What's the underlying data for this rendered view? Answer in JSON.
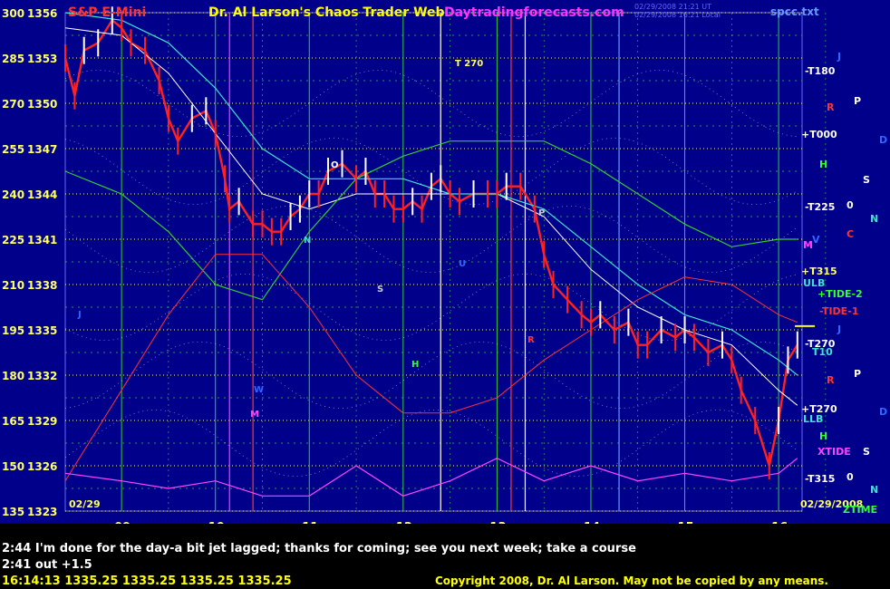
{
  "header": {
    "instrument": "S&P E-Mini",
    "author": "Dr. Al Larson's Chaos Trader Web",
    "site": "Daytradingforecasts.com",
    "timestamp1": "02/29/2008 21:21 UT",
    "timestamp2": "02/29/2008 16:21 Local",
    "file": "spcc.txt"
  },
  "colors": {
    "background": "#00008b",
    "price": "#ff0000",
    "price_up": "#ffffff",
    "grid_yellow": "#ffff66",
    "grid_green": "#33cc33",
    "cyan": "#40e0d0",
    "magenta": "#ff00ff"
  },
  "chart_data": {
    "type": "line",
    "y_left_labels": [
      "300",
      "285",
      "270",
      "255",
      "240",
      "225",
      "210",
      "195",
      "180",
      "165",
      "150",
      "135"
    ],
    "y_right_labels": [
      "1356",
      "1353",
      "1350",
      "1347",
      "1344",
      "1341",
      "1338",
      "1335",
      "1332",
      "1329",
      "1326",
      "1323"
    ],
    "ylim": [
      1323,
      1356
    ],
    "x_ticks": [
      "09",
      "10",
      "11",
      "12",
      "13",
      "14",
      "15",
      "16"
    ],
    "x_range": [
      8.4,
      16.25
    ],
    "date_left": "02/29",
    "date_right": "02/29/2008",
    "series": [
      {
        "name": "price",
        "x": [
          8.4,
          8.5,
          8.6,
          8.75,
          8.9,
          9.0,
          9.1,
          9.25,
          9.4,
          9.5,
          9.6,
          9.75,
          9.9,
          10.0,
          10.1,
          10.15,
          10.25,
          10.4,
          10.5,
          10.6,
          10.7,
          10.8,
          10.9,
          11.0,
          11.1,
          11.2,
          11.35,
          11.5,
          11.6,
          11.7,
          11.8,
          11.9,
          12.0,
          12.1,
          12.2,
          12.3,
          12.4,
          12.5,
          12.6,
          12.75,
          12.9,
          13.0,
          13.1,
          13.25,
          13.4,
          13.5,
          13.6,
          13.75,
          13.9,
          14.0,
          14.1,
          14.25,
          14.4,
          14.5,
          14.6,
          14.75,
          14.9,
          15.0,
          15.1,
          15.25,
          15.4,
          15.5,
          15.6,
          15.75,
          15.9,
          16.0,
          16.1,
          16.2
        ],
        "y": [
          1353,
          1350.5,
          1353.5,
          1354,
          1355.5,
          1355,
          1354,
          1353.5,
          1351.5,
          1349,
          1347.5,
          1349,
          1349.5,
          1348,
          1345,
          1343,
          1343.5,
          1342,
          1342,
          1341.5,
          1341.5,
          1342.5,
          1343,
          1344,
          1344,
          1345.5,
          1346,
          1345,
          1345.5,
          1344,
          1344,
          1343,
          1343,
          1343.5,
          1343,
          1344.5,
          1345,
          1344,
          1343.5,
          1344,
          1344,
          1344,
          1344.5,
          1344.5,
          1343,
          1340,
          1338,
          1337,
          1336,
          1335.5,
          1336,
          1335,
          1335.5,
          1334,
          1334,
          1335,
          1334.5,
          1335,
          1334.5,
          1333.5,
          1334,
          1333,
          1331,
          1329,
          1326,
          1329,
          1333,
          1334
        ]
      },
      {
        "name": "",
        "x": [
          8.4,
          9,
          9.5,
          10,
          10.5,
          11,
          11.5,
          12,
          12.5,
          13,
          13.5,
          14,
          14.5,
          15,
          15.5,
          16,
          16.2
        ],
        "y": [
          1355,
          1354.5,
          1352,
          1348,
          1344,
          1343,
          1344,
          1344,
          1344,
          1344,
          1342.5,
          1339,
          1336.5,
          1335,
          1334,
          1331,
          1330
        ]
      },
      {
        "name": "",
        "x": [
          8.4,
          9,
          9.5,
          10,
          10.5,
          11,
          11.5,
          12,
          12.5,
          13,
          13.5,
          14,
          14.5,
          15,
          15.5,
          16,
          16.2
        ],
        "y": [
          1356,
          1355.5,
          1354,
          1351,
          1347,
          1345,
          1345,
          1345,
          1344,
          1344,
          1343,
          1340.5,
          1338,
          1336,
          1335,
          1333,
          1332
        ]
      },
      {
        "name": "",
        "x": [
          8.4,
          9,
          9.5,
          10,
          10.5,
          11,
          11.5,
          12,
          12.5,
          13,
          13.5,
          14,
          14.5,
          15,
          15.5,
          16,
          16.2
        ],
        "y": [
          1345.5,
          1344,
          1341.5,
          1338,
          1337,
          1341.5,
          1345,
          1346.5,
          1347.5,
          1347.5,
          1347.5,
          1346,
          1344,
          1342,
          1340.5,
          1341,
          1341
        ]
      },
      {
        "name": "",
        "x": [
          8.4,
          9,
          9.5,
          10,
          10.5,
          11,
          11.5,
          12,
          12.5,
          13,
          13.5,
          14,
          14.5,
          15,
          15.5,
          16,
          16.2
        ],
        "y": [
          1325,
          1331,
          1336,
          1340,
          1340,
          1336.5,
          1332,
          1329.5,
          1329.5,
          1330.5,
          1333,
          1335,
          1337,
          1338.5,
          1338,
          1336,
          1335.5
        ]
      },
      {
        "name": "",
        "x": [
          8.4,
          9,
          9.5,
          10,
          10.5,
          11,
          11.5,
          12,
          12.5,
          13,
          13.5,
          14,
          14.5,
          15,
          15.5,
          16,
          16.2
        ],
        "y": [
          1325.5,
          1325,
          1324.5,
          1325,
          1324,
          1324,
          1326,
          1324,
          1325,
          1326.5,
          1325,
          1326,
          1325,
          1325.5,
          1325,
          1325.5,
          1326.5
        ]
      }
    ]
  },
  "right_labels": {
    "t180": "-T180",
    "t000": "+T000",
    "t225": "-T225",
    "t315": "+T315",
    "ulb": "ULB",
    "tide2": "+TIDE-2",
    "tide1": "-TIDE-1",
    "t270a": "-T270",
    "t10": "T10",
    "t270b": "+T270",
    "llb": "LLB",
    "xtide": "XTIDE",
    "t315b": "-T315",
    "ztime": "ZTIME"
  },
  "planet_glyphs": {
    "j1": "J",
    "p1": "P",
    "r1": "R",
    "d1": "D",
    "h1": "H",
    "s1": "S",
    "o1": "0",
    "n1": "N",
    "c1": "C",
    "m1": "M",
    "v1": "V",
    "j2": "J",
    "p2": "P",
    "r2": "R",
    "d2": "D",
    "h2": "H",
    "s2": "S",
    "o2": "0",
    "n2": "N"
  },
  "chart_letters": {
    "o": "O",
    "n": "N",
    "s": "S",
    "u": "U",
    "h": "H",
    "p": "P",
    "w": "W",
    "m": "M",
    "j": "J",
    "r": "R"
  },
  "annotation_t270": "T 270",
  "footer": {
    "line1": "2:44 I'm done for the day-a bit jet lagged; thanks for coming; see you next week; take a course",
    "line2": "2:41 out +1.5",
    "quote": "16:14:13  1335.25  1335.25  1335.25  1335.25",
    "copyright": "Copyright 2008, Dr. Al Larson. May not be copied by any means."
  }
}
